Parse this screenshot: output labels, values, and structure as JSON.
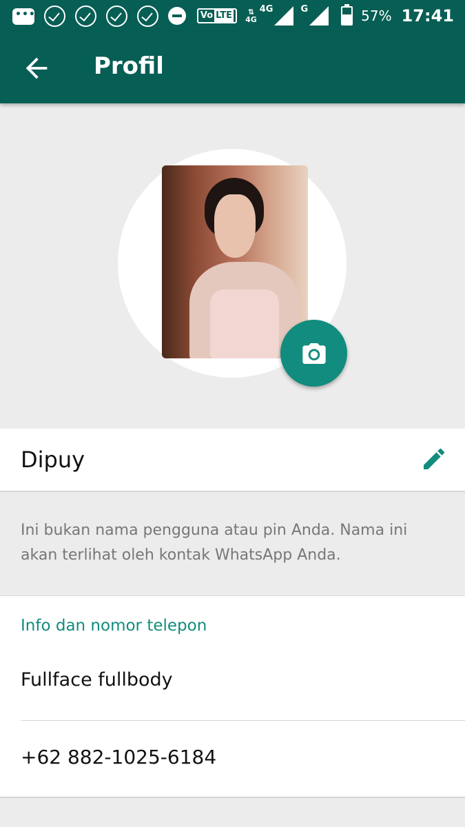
{
  "status_bar": {
    "volte_label": "Vo",
    "lte_label": "LTE",
    "net1_label": "4G",
    "net1_sub": "4G",
    "net2_label": "G",
    "battery_percent": "57%",
    "battery_level": 0.57,
    "time": "17:41"
  },
  "app_bar": {
    "title": "Profil"
  },
  "profile": {
    "name": "Dipuy",
    "name_hint": "Ini bukan nama pengguna atau pin Anda. Nama ini akan terlihat oleh kontak WhatsApp Anda."
  },
  "info": {
    "heading": "Info dan nomor telepon",
    "about": "Fullface fullbody",
    "phone": "+62 882-1025-6184"
  },
  "colors": {
    "primary_dark": "#075e54",
    "accent": "#128c7e"
  }
}
